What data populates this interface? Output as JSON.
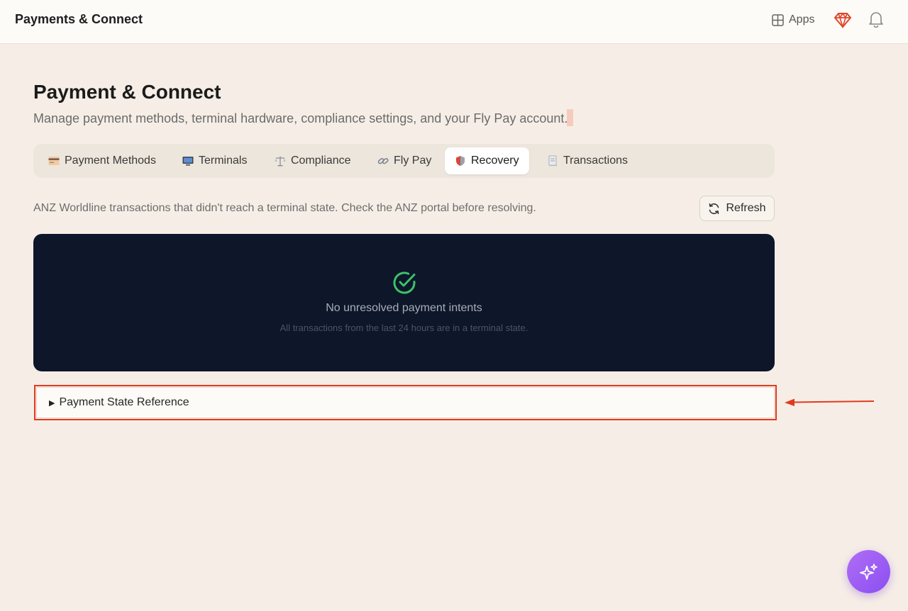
{
  "topbar": {
    "title": "Payments & Connect",
    "apps_label": "Apps",
    "icons": [
      "grid-icon",
      "gem-icon",
      "bell-icon"
    ]
  },
  "header": {
    "title": "Payment & Connect",
    "subtitle": "Manage payment methods, terminal hardware, compliance settings, and your Fly Pay account."
  },
  "tabs": [
    {
      "label": "Payment Methods",
      "icon": "card-icon",
      "active": false
    },
    {
      "label": "Terminals",
      "icon": "monitor-icon",
      "active": false
    },
    {
      "label": "Compliance",
      "icon": "scales-icon",
      "active": false
    },
    {
      "label": "Fly Pay",
      "icon": "link-icon",
      "active": false
    },
    {
      "label": "Recovery",
      "icon": "shield-icon",
      "active": true
    },
    {
      "label": "Transactions",
      "icon": "receipt-icon",
      "active": false
    }
  ],
  "recovery": {
    "description": "ANZ Worldline transactions that didn't reach a terminal state. Check the ANZ portal before resolving.",
    "refresh_label": "Refresh",
    "empty_title": "No unresolved payment intents",
    "empty_subtitle": "All transactions from the last 24 hours are in a terminal state.",
    "reference_label": "Payment State Reference"
  },
  "colors": {
    "background": "#f6eee6",
    "panel": "#0e1629",
    "success": "#3cc26a",
    "highlight": "#e23a1e",
    "fab_gradient": [
      "#b06ef5",
      "#8a4ff0"
    ]
  }
}
